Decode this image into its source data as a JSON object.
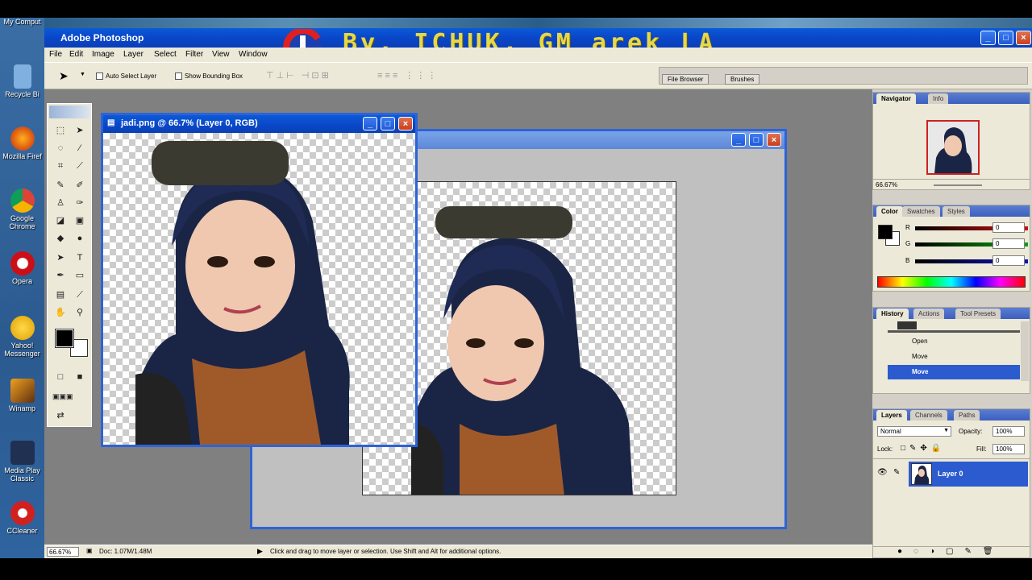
{
  "desktop": {
    "icons": [
      {
        "label": "My Comput"
      },
      {
        "label": "Recycle Bi"
      },
      {
        "label": "Mozilla Firef"
      },
      {
        "label": "Google Chrome"
      },
      {
        "label": "Opera"
      },
      {
        "label": "Yahoo! Messenger"
      },
      {
        "label": "Winamp"
      },
      {
        "label": "Media Play Classic"
      },
      {
        "label": "CCleaner"
      }
    ]
  },
  "app": {
    "title": "Adobe Photoshop"
  },
  "watermark": {
    "text": "By. ICHUK. GM arek LA"
  },
  "menu": [
    "File",
    "Edit",
    "Image",
    "Layer",
    "Select",
    "Filter",
    "View",
    "Window"
  ],
  "options": {
    "auto_select": "Auto Select Layer",
    "show_bbox": "Show Bounding Box",
    "file_browser": "File Browser",
    "brushes": "Brushes"
  },
  "document": {
    "title": "jadi.png @ 66.7% (Layer 0, RGB)"
  },
  "navigator": {
    "tabs": [
      "Navigator",
      "Info"
    ],
    "zoom": "66.67%"
  },
  "color": {
    "tabs": [
      "Color",
      "Swatches",
      "Styles"
    ],
    "channels": [
      {
        "label": "R",
        "value": "0",
        "color": "#d01010"
      },
      {
        "label": "G",
        "value": "0",
        "color": "#10a010"
      },
      {
        "label": "B",
        "value": "0",
        "color": "#1010c0"
      }
    ]
  },
  "history": {
    "tabs": [
      "History",
      "Actions",
      "Tool Presets"
    ],
    "items": [
      "Open",
      "Move",
      "Move"
    ]
  },
  "layers": {
    "tabs": [
      "Layers",
      "Channels",
      "Paths"
    ],
    "blend": "Normal",
    "opacity_label": "Opacity:",
    "opacity": "100%",
    "lock_label": "Lock:",
    "fill_label": "Fill:",
    "fill": "100%",
    "layer_name": "Layer 0"
  },
  "status": {
    "zoom": "66.67%",
    "doc": "Doc: 1.07M/1.48M",
    "hint": "Click and drag to move layer or selection.  Use Shift and Alt for additional options."
  }
}
